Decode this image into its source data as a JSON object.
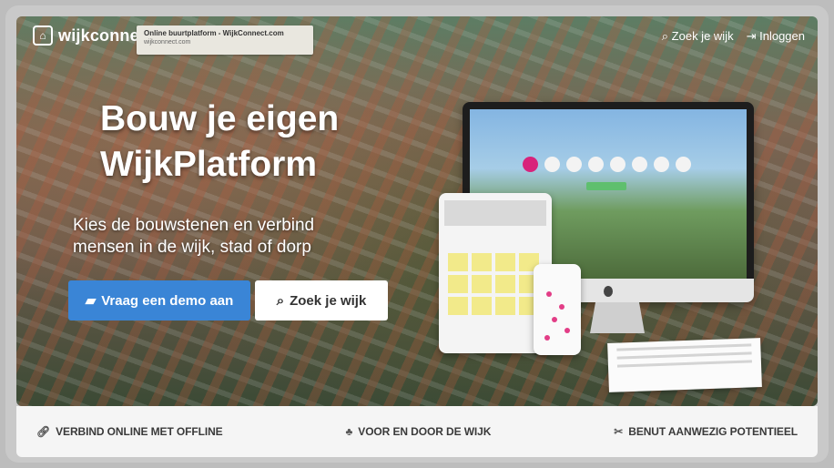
{
  "header": {
    "logo_icon": "speech-bubble-house-icon",
    "logo_text": "wijkconne",
    "tooltip_title": "Online buurtplatform - WijkConnect.com",
    "tooltip_url": "wijkconnect.com",
    "search_link": "Zoek je wijk",
    "login_link": "Inloggen"
  },
  "hero": {
    "headline_line1": "Bouw je eigen",
    "headline_line2": "WijkPlatform",
    "subline_line1": "Kies de bouwstenen en verbind",
    "subline_line2": "mensen in de wijk, stad of dorp",
    "demo_button": "Vraag een demo aan",
    "search_button": "Zoek je wijk"
  },
  "features": [
    {
      "icon": "link-icon",
      "label": "VERBIND ONLINE MET OFFLINE"
    },
    {
      "icon": "group-icon",
      "label": "VOOR EN DOOR DE WIJK"
    },
    {
      "icon": "tools-icon",
      "label": "BENUT AANWEZIG POTENTIEEL"
    }
  ],
  "colors": {
    "demo_button": "#3a85d6",
    "accent_pink": "#d8237b"
  }
}
